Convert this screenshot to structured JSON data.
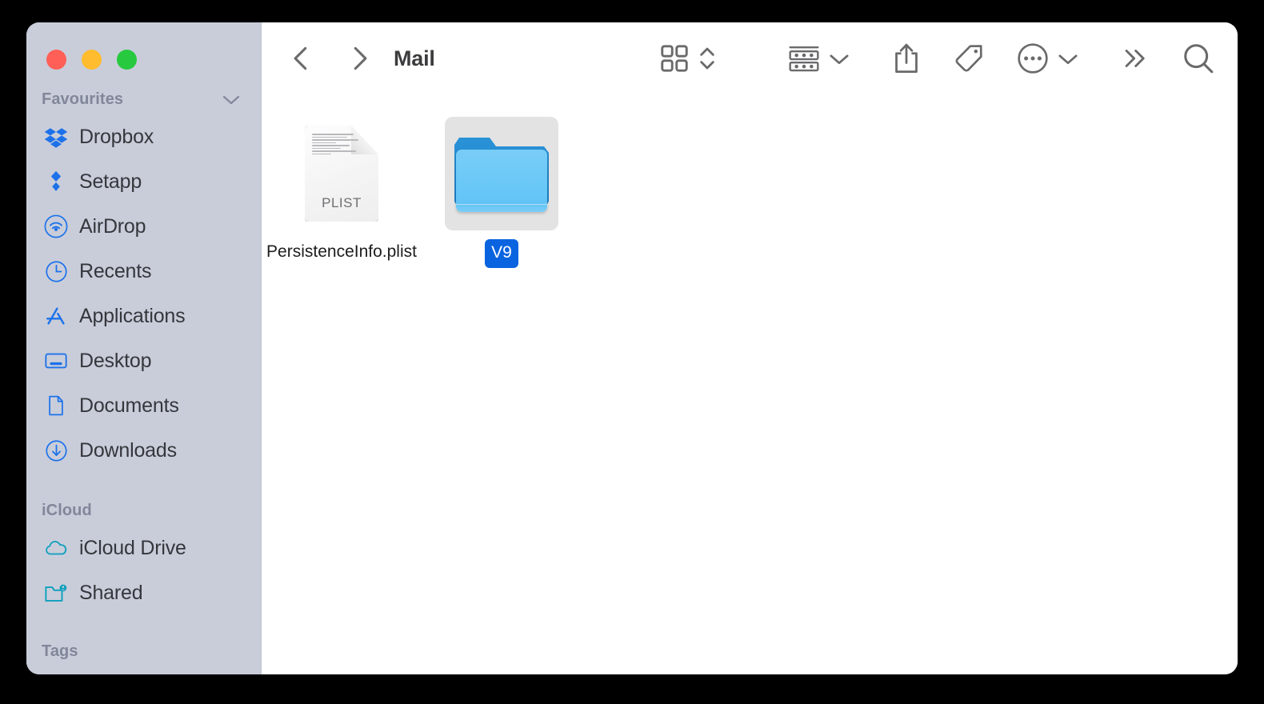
{
  "window": {
    "title": "Mail",
    "traffic_lights": [
      {
        "name": "close",
        "color": "#ff5f56"
      },
      {
        "name": "minimize",
        "color": "#febc2e"
      },
      {
        "name": "zoom",
        "color": "#27c93f"
      }
    ]
  },
  "sidebar": {
    "sections": [
      {
        "header": "Favourites",
        "collapsible": true,
        "items": [
          {
            "label": "Dropbox",
            "icon": "dropbox-icon",
            "color": "#1d72ea"
          },
          {
            "label": "Setapp",
            "icon": "setapp-icon",
            "color": "#1d72ea"
          },
          {
            "label": "AirDrop",
            "icon": "airdrop-icon",
            "color": "#1d72ea"
          },
          {
            "label": "Recents",
            "icon": "clock-icon",
            "color": "#1d72ea"
          },
          {
            "label": "Applications",
            "icon": "applications-icon",
            "color": "#1d72ea"
          },
          {
            "label": "Desktop",
            "icon": "desktop-icon",
            "color": "#1d72ea"
          },
          {
            "label": "Documents",
            "icon": "document-icon",
            "color": "#1d72ea"
          },
          {
            "label": "Downloads",
            "icon": "downloads-icon",
            "color": "#1d72ea"
          }
        ]
      },
      {
        "header": "iCloud",
        "collapsible": false,
        "items": [
          {
            "label": "iCloud Drive",
            "icon": "cloud-icon",
            "color": "#0c9fbd"
          },
          {
            "label": "Shared",
            "icon": "shared-folder-icon",
            "color": "#0c9fbd"
          }
        ]
      },
      {
        "header": "Tags",
        "collapsible": false,
        "items": []
      }
    ]
  },
  "toolbar": {
    "back_label": "Back",
    "forward_label": "Forward",
    "title": "Mail",
    "buttons": [
      {
        "name": "icon-view-button",
        "icon": "grid-view-icon",
        "label": "Icon View"
      },
      {
        "name": "view-stepper-button",
        "icon": "chevron-up-down-icon",
        "label": "Change View"
      },
      {
        "name": "group-by-button",
        "icon": "group-by-icon",
        "label": "Group"
      },
      {
        "name": "group-by-chevron",
        "icon": "chevron-down-icon",
        "label": "Group options"
      },
      {
        "name": "share-button",
        "icon": "share-icon",
        "label": "Share"
      },
      {
        "name": "tag-button",
        "icon": "tag-icon",
        "label": "Tags"
      },
      {
        "name": "more-button",
        "icon": "ellipsis-circle-icon",
        "label": "More"
      },
      {
        "name": "more-chevron",
        "icon": "chevron-down-icon",
        "label": "More options"
      },
      {
        "name": "overflow-button",
        "icon": "double-chevron-right-icon",
        "label": "More toolbar items"
      },
      {
        "name": "search-button",
        "icon": "search-icon",
        "label": "Search"
      }
    ]
  },
  "files": [
    {
      "name": "PersistenceInfo.plist",
      "type": "file",
      "extension_badge": "PLIST",
      "selected": false
    },
    {
      "name": "V9",
      "type": "folder",
      "selected": true
    }
  ],
  "colors": {
    "sidebar_background": "#c9cdda",
    "content_background": "#ffffff",
    "selection_blue": "#0a64e0",
    "selection_gray": "#e3e3e3",
    "sidebar_label": "#35373c",
    "section_header": "#82869a",
    "toolbar_icon": "#6a6a6c",
    "folder_blue": "#66c6f6"
  }
}
